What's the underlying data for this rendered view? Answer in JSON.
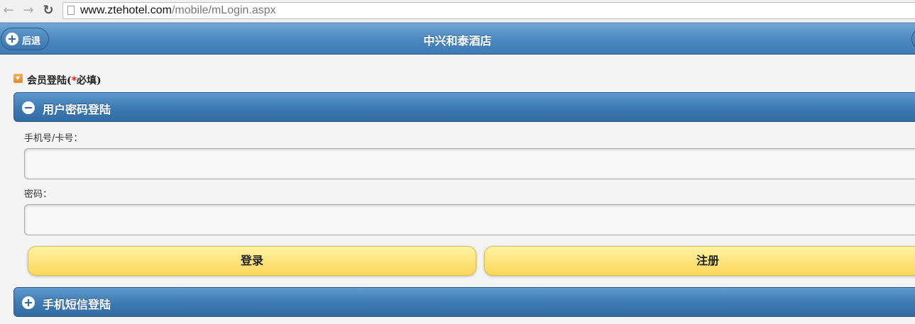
{
  "browser": {
    "url_host": "www.ztehotel.com",
    "url_path": "/mobile/mLogin.aspx"
  },
  "header": {
    "back_label": "后退",
    "title": "中兴和泰酒店"
  },
  "member_section": {
    "label": "会员登陆(",
    "required_mark": "*",
    "required_text": "必填)"
  },
  "password_login": {
    "title": "用户密码登陆",
    "phone_label": "手机号/卡号：",
    "phone_value": "",
    "password_label": "密码：",
    "password_value": "",
    "login_button": "登录",
    "register_button": "注册"
  },
  "sms_login": {
    "title": "手机短信登陆"
  },
  "colors": {
    "header_blue": "#4a87c0",
    "button_yellow": "#fde47a",
    "heading_icon_orange": "#e8862a"
  }
}
